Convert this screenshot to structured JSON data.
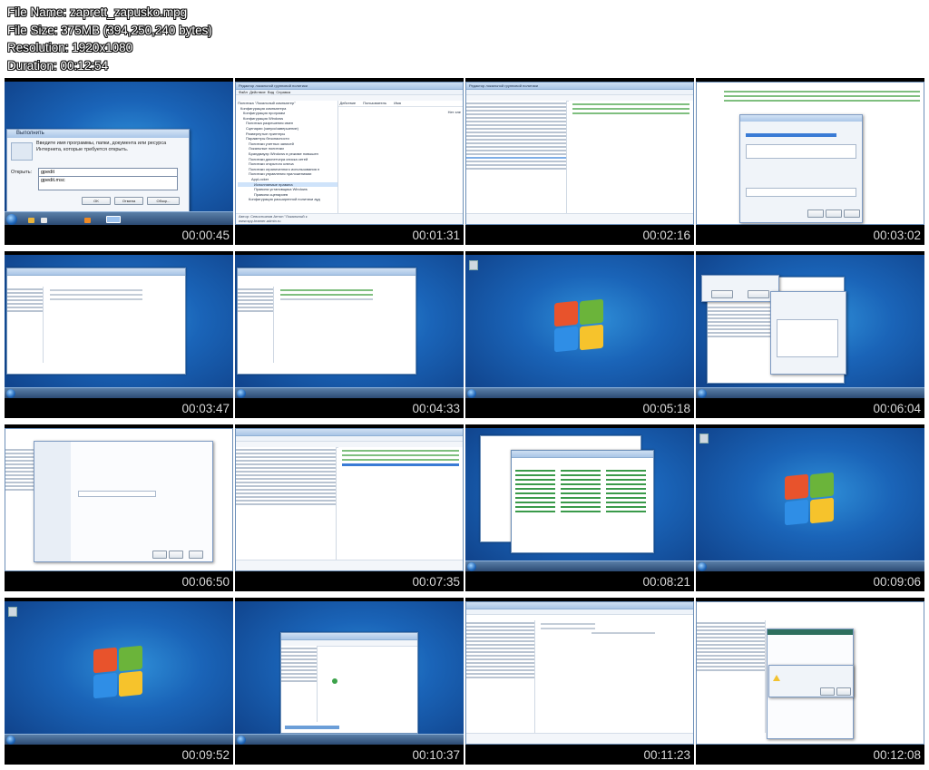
{
  "meta": {
    "file_name": "File Name: zaprett_zapusko.mpg",
    "file_size": "File Size: 375MB (394,250,240 bytes)",
    "resolution": "Resolution: 1920x1080",
    "duration": "Duration: 00:12:54"
  },
  "thumbnails": [
    {
      "time": "00:00:45",
      "scene": "run-dialog"
    },
    {
      "time": "00:01:31",
      "scene": "gpedit"
    },
    {
      "time": "00:02:16",
      "scene": "gpedit-rules"
    },
    {
      "time": "00:03:02",
      "scene": "permission-dialog"
    },
    {
      "time": "00:03:47",
      "scene": "gpedit-small"
    },
    {
      "time": "00:04:33",
      "scene": "gpedit-small"
    },
    {
      "time": "00:05:18",
      "scene": "desktop"
    },
    {
      "time": "00:06:04",
      "scene": "dialog-desktop"
    },
    {
      "time": "00:06:50",
      "scene": "wizard"
    },
    {
      "time": "00:07:35",
      "scene": "gpedit-rules-selected"
    },
    {
      "time": "00:08:21",
      "scene": "control-panel"
    },
    {
      "time": "00:09:06",
      "scene": "desktop"
    },
    {
      "time": "00:09:52",
      "scene": "desktop"
    },
    {
      "time": "00:10:37",
      "scene": "explorer"
    },
    {
      "time": "00:11:23",
      "scene": "gpedit-wide"
    },
    {
      "time": "00:12:08",
      "scene": "warning-dialog"
    }
  ],
  "run_dialog": {
    "title": "Выполнить",
    "prompt": "Введите имя программы, папки, документа или ресурса Интернета, которые требуется открыть.",
    "open_label": "Открыть:",
    "input_value": "gpedit",
    "suggestion": "gpedit.msc",
    "ok": "OK",
    "cancel": "Отмена",
    "browse": "Обзор..."
  },
  "gpedit": {
    "title": "Редактор локальной групповой политики",
    "menu": [
      "Файл",
      "Действие",
      "Вид",
      "Справка"
    ],
    "tree": [
      "Политика \"Локальный компьютер\"",
      "Конфигурация компьютера",
      "Конфигурация программ",
      "Конфигурация Windows",
      "Политика разрешения имен",
      "Сценарии (запуск/завершение)",
      "Развернутые принтеры",
      "Параметры безопасности",
      "Политики учетных записей",
      "Локальные политики",
      "Брандмауэр Windows в режиме повышен",
      "Политики диспетчера списка сетей",
      "Политики открытого ключа",
      "Политики ограниченного использования п",
      "Политики управления приложениями",
      "AppLocker",
      "Исполняемые правила",
      "Правила установщика Windows",
      "Правила сценариев",
      "Конфигурация расширенной политики ауд"
    ],
    "columns": [
      "Действие",
      "Пользователь",
      "Имя"
    ],
    "right_text": "Нет эле",
    "watermark": "Автор: Севостьянов Антон \"Локальный к",
    "watermark2": "www.spy-teamer-admin.ru"
  },
  "colors": {
    "desktop": "#1a64b8",
    "accent": "#3a7bd5",
    "taskbar": "#2b4a73"
  }
}
